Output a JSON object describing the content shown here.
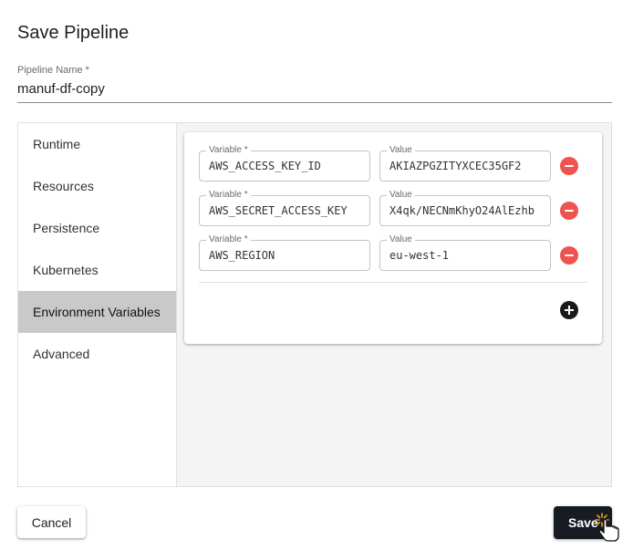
{
  "dialog": {
    "title": "Save Pipeline"
  },
  "pipeline_name": {
    "label": "Pipeline Name *",
    "value": "manuf-df-copy"
  },
  "sidebar": {
    "items": [
      {
        "label": "Runtime"
      },
      {
        "label": "Resources"
      },
      {
        "label": "Persistence"
      },
      {
        "label": "Kubernetes"
      },
      {
        "label": "Environment Variables",
        "active": true
      },
      {
        "label": "Advanced"
      }
    ]
  },
  "env_vars": {
    "variable_label": "Variable *",
    "value_label": "Value",
    "rows": [
      {
        "variable": "AWS_ACCESS_KEY_ID",
        "value": "AKIAZPGZITYXCEC35GF2"
      },
      {
        "variable": "AWS_SECRET_ACCESS_KEY",
        "value": "X4qk/NECNmKhyO24AlEzhb"
      },
      {
        "variable": "AWS_REGION",
        "value": "eu-west-1"
      }
    ],
    "remove_icon": "minus-circle-icon",
    "add_icon": "plus-circle-icon"
  },
  "actions": {
    "cancel_label": "Cancel",
    "save_label": "Save"
  },
  "colors": {
    "remove": "#ef5350",
    "save_bg": "#161c22",
    "active_item_bg": "#c9c9c9"
  }
}
